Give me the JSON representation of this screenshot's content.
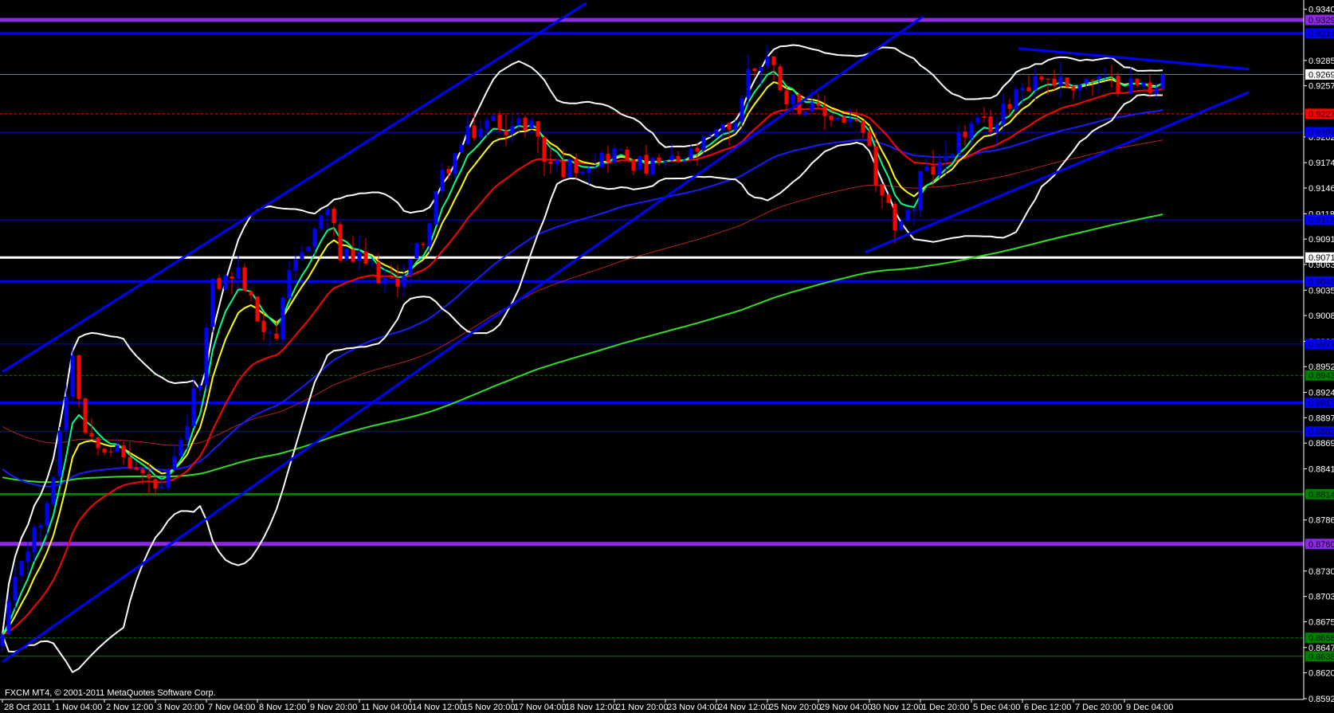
{
  "window": {
    "copyright": "FXCM MT4, © 2001-2011 MetaQuotes Software Corp."
  },
  "chart_data": {
    "type": "candlestick",
    "title": "",
    "bull_color": "#0000ff",
    "bear_color": "#ff0000",
    "ylim": [
      0.8592,
      0.93405
    ],
    "price_ticks": [
      "0.93405",
      "0.92850",
      "0.92575",
      "0.92020",
      "0.91740",
      "0.91465",
      "0.91185",
      "0.90910",
      "0.90635",
      "0.90355",
      "0.90080",
      "0.89800",
      "0.89525",
      "0.89245",
      "0.88970",
      "0.88695",
      "0.88415",
      "0.87860",
      "0.87305",
      "0.87030",
      "0.86755",
      "0.86475",
      "0.86200",
      "0.85920"
    ],
    "time_labels": [
      "28 Oct 2011",
      "1 Nov 04:00",
      "2 Nov 12:00",
      "3 Nov 20:00",
      "7 Nov 04:00",
      "8 Nov 12:00",
      "9 Nov 20:00",
      "11 Nov 04:00",
      "14 Nov 12:00",
      "15 Nov 20:00",
      "17 Nov 04:00",
      "18 Nov 12:00",
      "21 Nov 20:00",
      "23 Nov 04:00",
      "24 Nov 12:00",
      "25 Nov 20:00",
      "29 Nov 04:00",
      "30 Nov 12:00",
      "1 Dec 20:00",
      "5 Dec 04:00",
      "6 Dec 12:00",
      "7 Dec 20:00",
      "9 Dec 04:00"
    ],
    "bars_per_time_label": 8,
    "bar_count": 183,
    "price_path": [
      [
        0,
        0.8658
      ],
      [
        3,
        0.8745
      ],
      [
        7,
        0.8796
      ],
      [
        9,
        0.8883
      ],
      [
        11,
        0.8969
      ],
      [
        13,
        0.8883
      ],
      [
        17,
        0.8866
      ],
      [
        21,
        0.884
      ],
      [
        25,
        0.8814
      ],
      [
        28,
        0.8866
      ],
      [
        31,
        0.8943
      ],
      [
        33,
        0.9039
      ],
      [
        37,
        0.9056
      ],
      [
        40,
        0.9004
      ],
      [
        43,
        0.8987
      ],
      [
        45,
        0.9047
      ],
      [
        48,
        0.9091
      ],
      [
        51,
        0.9125
      ],
      [
        53,
        0.9073
      ],
      [
        57,
        0.9065
      ],
      [
        61,
        0.9039
      ],
      [
        64,
        0.9065
      ],
      [
        67,
        0.9108
      ],
      [
        69,
        0.916
      ],
      [
        73,
        0.9203
      ],
      [
        77,
        0.922
      ],
      [
        80,
        0.9212
      ],
      [
        83,
        0.922
      ],
      [
        85,
        0.9177
      ],
      [
        88,
        0.9168
      ],
      [
        93,
        0.9177
      ],
      [
        96,
        0.9186
      ],
      [
        101,
        0.9168
      ],
      [
        107,
        0.9177
      ],
      [
        112,
        0.9203
      ],
      [
        115,
        0.922
      ],
      [
        117,
        0.9272
      ],
      [
        120,
        0.9289
      ],
      [
        123,
        0.9246
      ],
      [
        127,
        0.9229
      ],
      [
        133,
        0.922
      ],
      [
        136,
        0.9194
      ],
      [
        137,
        0.9142
      ],
      [
        140,
        0.9108
      ],
      [
        143,
        0.9125
      ],
      [
        144,
        0.916
      ],
      [
        147,
        0.9168
      ],
      [
        149,
        0.9194
      ],
      [
        152,
        0.9212
      ],
      [
        156,
        0.9216
      ],
      [
        159,
        0.9255
      ],
      [
        163,
        0.9268
      ],
      [
        167,
        0.9259
      ],
      [
        171,
        0.9264
      ],
      [
        173,
        0.9262
      ],
      [
        177,
        0.9259
      ],
      [
        180,
        0.9255
      ],
      [
        182,
        0.927
      ]
    ],
    "indicators": [
      {
        "type": "ema",
        "period": 200,
        "color": "#33dd22",
        "width": 2,
        "seed": 0.8834
      },
      {
        "type": "ema",
        "period": 100,
        "color": "#b22222",
        "width": 1,
        "seed": 0.8892
      },
      {
        "type": "ema",
        "period": 55,
        "color": "#1a1aff",
        "width": 2,
        "seed": 0.8848
      },
      {
        "type": "bollinger",
        "period": 20,
        "deviation": 2,
        "color": "#ffffff",
        "width": 2
      },
      {
        "type": "ema",
        "period": 21,
        "color": "#ff0000",
        "width": 2
      },
      {
        "type": "ema",
        "period": 8,
        "color": "#ffff00",
        "width": 2
      },
      {
        "type": "ema",
        "period": 5,
        "color": "#00ff88",
        "width": 2
      }
    ],
    "horizontal_lines": [
      {
        "price": 0.9329,
        "label": "0.93290",
        "color": "#8a2be2",
        "width": 5,
        "style": "solid",
        "text_color": "#1a0033"
      },
      {
        "price": 0.93144,
        "label": "0.93144",
        "color": "#0000ff",
        "width": 3,
        "style": "solid",
        "text_color": "#000044"
      },
      {
        "price": 0.92698,
        "label": "0.92698",
        "color": "#778899",
        "width": 1,
        "style": "solid",
        "box_color": "#ffffff",
        "text_color": "#000000"
      },
      {
        "price": 0.9227,
        "label": "0.92270",
        "color": "#ff0000",
        "width": 1,
        "style": "dashed",
        "text_color": "#330000"
      },
      {
        "price": 0.9207,
        "label": "0.92070",
        "color": "#0000ff",
        "width": 1,
        "style": "solid",
        "text_color": "#000044"
      },
      {
        "price": 0.9112,
        "label": "0.91120",
        "color": "#0000ff",
        "width": 1,
        "style": "solid",
        "text_color": "#000044"
      },
      {
        "price": 0.9071,
        "label": "0.90710",
        "color": "#ffffff",
        "width": 3,
        "style": "solid",
        "text_color": "#000000"
      },
      {
        "price": 0.9045,
        "label": "0.90450",
        "color": "#0000ff",
        "width": 3,
        "style": "solid",
        "text_color": "#000044"
      },
      {
        "price": 0.8977,
        "label": "0.89770",
        "color": "#0000ff",
        "width": 1,
        "style": "solid",
        "text_color": "#000044"
      },
      {
        "price": 0.8943,
        "label": "0.89430",
        "color": "#008000",
        "width": 1,
        "style": "dashed",
        "text_color": "#002200"
      },
      {
        "price": 0.89132,
        "label": "0.89132",
        "color": "#0000ff",
        "width": 3,
        "style": "solid",
        "text_color": "#000044"
      },
      {
        "price": 0.8882,
        "label": "0.88820",
        "color": "#0000ff",
        "width": 1,
        "style": "solid",
        "text_color": "#000044"
      },
      {
        "price": 0.8814,
        "label": "0.88140",
        "color": "#008000",
        "width": 3,
        "style": "solid",
        "text_color": "#002200"
      },
      {
        "price": 0.876,
        "label": "0.87600",
        "color": "#8a2be2",
        "width": 5,
        "style": "solid",
        "text_color": "#1a0033"
      },
      {
        "price": 0.8658,
        "label": "0.86580",
        "color": "#008000",
        "width": 1,
        "style": "dashed",
        "text_color": "#002200"
      },
      {
        "price": 0.8638,
        "label": "0.86380",
        "color": "#008000",
        "width": 1,
        "style": "solid",
        "text_color": "#002200"
      }
    ],
    "trendlines": [
      {
        "from": [
          0,
          0.89468
        ],
        "to": [
          91.6,
          0.93474
        ],
        "color": "#0000ff"
      },
      {
        "from": [
          0,
          0.86318
        ],
        "to": [
          144.4,
          0.93327
        ],
        "color": "#0000ff"
      },
      {
        "from": [
          159.4,
          0.92981
        ],
        "to": [
          195.5,
          0.92756
        ],
        "color": "#0000ff"
      },
      {
        "from": [
          135.3,
          0.90766
        ],
        "to": [
          195.5,
          0.92505
        ],
        "color": "#0000ff"
      }
    ]
  }
}
